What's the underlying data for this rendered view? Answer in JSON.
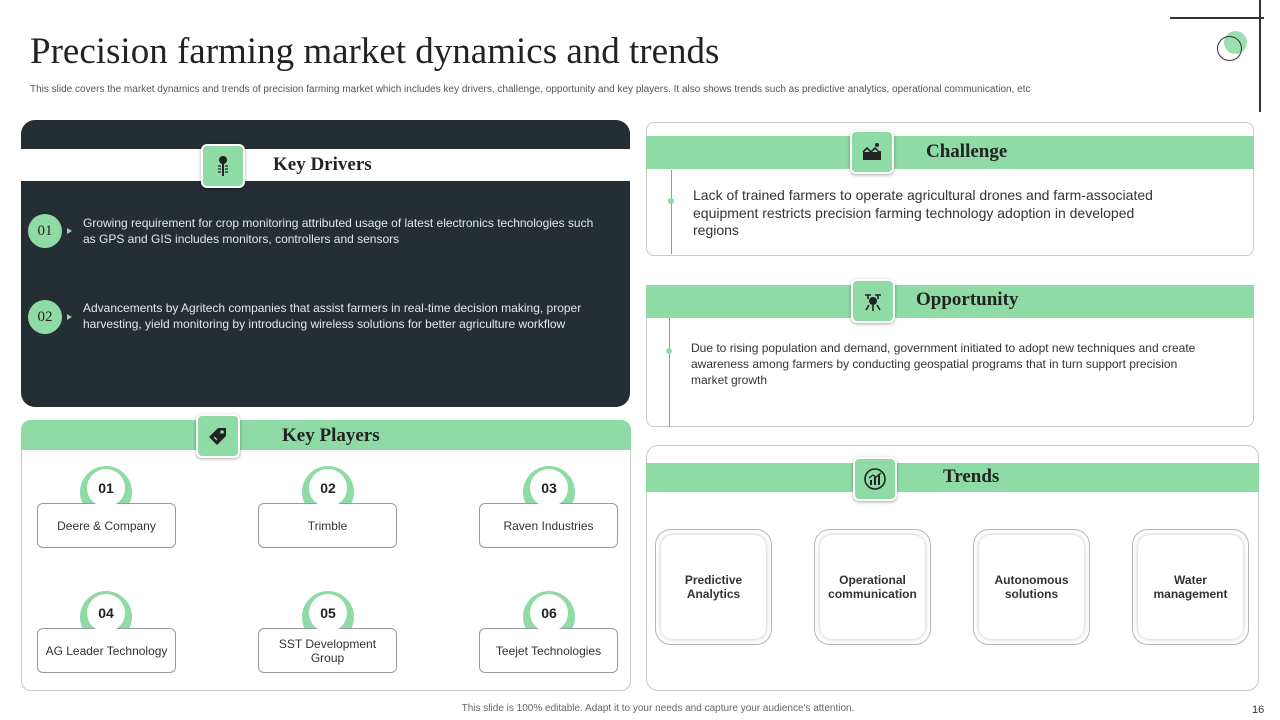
{
  "header": {
    "title": "Precision farming market dynamics and trends",
    "subtitle": "This slide covers the market dynamics and trends of precision farming market which includes key drivers, challenge, opportunity and key players. It also shows trends such as predictive analytics, operational communication,  etc"
  },
  "key_drivers": {
    "title": "Key Drivers",
    "icon": "sensor-probe-icon",
    "items": [
      {
        "number": "01",
        "text": "Growing requirement  for crop monitoring attributed usage of latest electronics technologies such as GPS and GIS includes monitors, controllers and sensors"
      },
      {
        "number": "02",
        "text": "Advancements  by Agritech companies that assist farmers in real-time decision making, proper harvesting,  yield monitoring by introducing wireless solutions for better agriculture workflow"
      }
    ]
  },
  "challenge": {
    "title": "Challenge",
    "icon": "farm-fence-icon",
    "text": "Lack of trained farmers to operate agricultural drones and farm-associated equipment restricts precision farming technology adoption in developed regions"
  },
  "opportunity": {
    "title": "Opportunity",
    "icon": "agri-drone-icon",
    "text": "Due to rising population and demand,  government  initiated to adopt new techniques and create awareness  among farmers  by conducting geospatial programs that in turn support precision market growth"
  },
  "key_players": {
    "title": "Key Players",
    "icon": "price-tag-icon",
    "items": [
      {
        "number": "01",
        "name": "Deere & Company"
      },
      {
        "number": "02",
        "name": "Trimble"
      },
      {
        "number": "03",
        "name": "Raven Industries"
      },
      {
        "number": "04",
        "name": "AG Leader Technology"
      },
      {
        "number": "05",
        "name": "SST Development Group"
      },
      {
        "number": "06",
        "name": "Teejet Technologies"
      }
    ]
  },
  "trends": {
    "title": "Trends",
    "icon": "growth-chart-icon",
    "items": [
      {
        "label": "Predictive Analytics"
      },
      {
        "label": "Operational communication"
      },
      {
        "label": "Autonomous solutions"
      },
      {
        "label": "Water management"
      }
    ]
  },
  "footer": {
    "note": "This slide is 100% editable.  Adapt it to your needs and capture your audience's attention.",
    "page": "16"
  },
  "colors": {
    "accent": "#8fdba6",
    "dark_panel": "#252e33"
  }
}
